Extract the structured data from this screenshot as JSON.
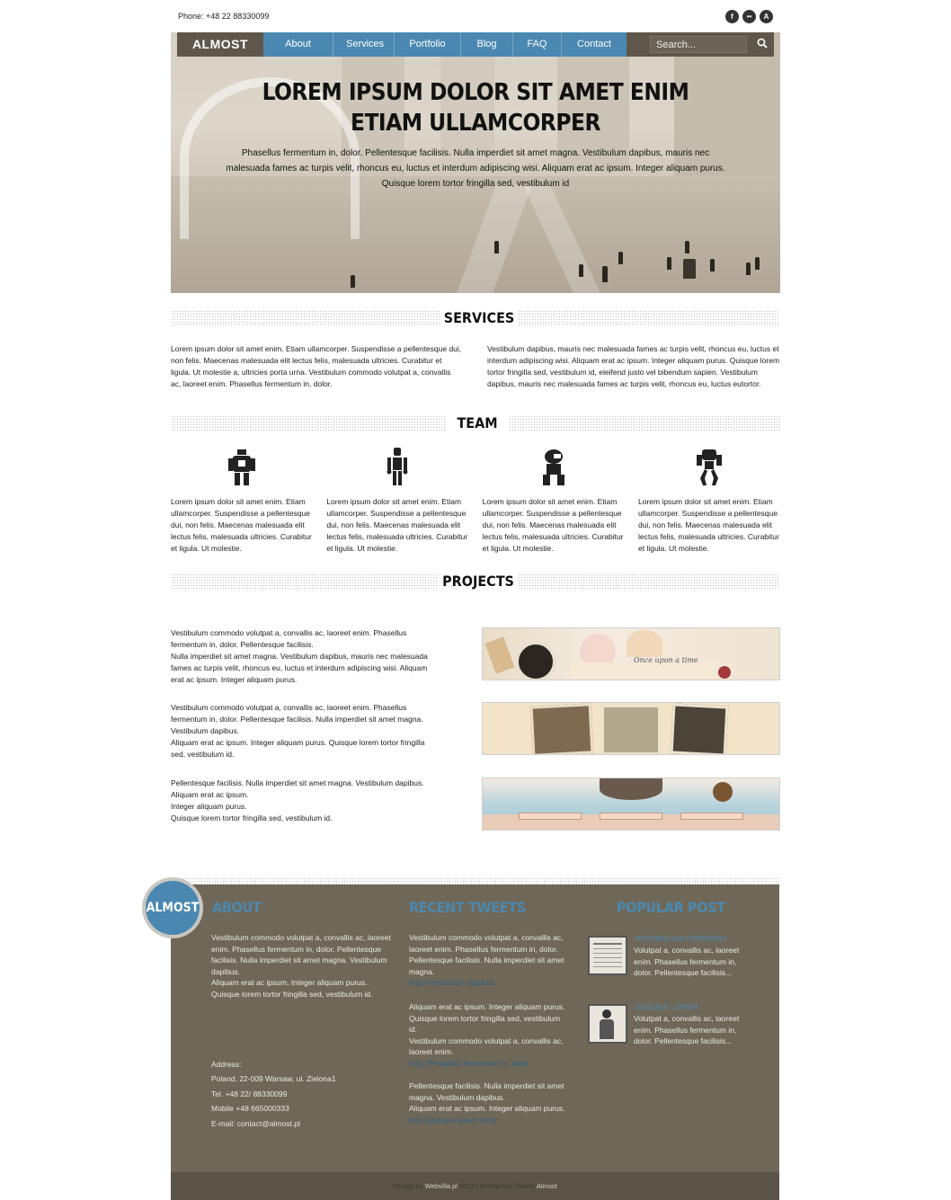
{
  "topbar": {
    "phone": "Phone: +48 22 88330099",
    "social": [
      {
        "icon": "facebook-icon",
        "glyph": "f"
      },
      {
        "icon": "flickr-icon",
        "glyph": "••"
      },
      {
        "icon": "deviantart-icon",
        "glyph": "A"
      }
    ]
  },
  "nav": {
    "logo": "ALMOST",
    "items": [
      "About",
      "Services",
      "Portfolio",
      "Blog",
      "FAQ",
      "Contact"
    ],
    "search_placeholder": "Search..."
  },
  "hero": {
    "title_line1": "LOREM IPSUM DOLOR SIT AMET ENIM",
    "title_line2": "ETIAM ULLAMCORPER",
    "text": "Phasellus fermentum in, dolor. Pellentesque facilisis. Nulla imperdiet sit amet magna. Vestibulum dapibus, mauris nec malesuada fames ac turpis velit, rhoncus eu, luctus et interdum adipiscing wisi. Aliquam erat ac ipsum. Integer aliquam purus. Quisque lorem tortor fringilla sed, vestibulum id"
  },
  "services": {
    "title": "SERVICES",
    "left": "Lorem ipsum dolor sit amet enim. Etiam ullamcorper. Suspendisse a pellentesque dui, non felis. Maecenas malesuada elit lectus felis, malesuada ultricies. Curabitur et ligula. Ut molestie a, ultricies porta urna. Vestibulum commodo volutpat a, convallis ac, laoreet enim. Phasellus fermentum in, dolor.",
    "right": "Vestibulum dapibus, mauris nec malesuada fames ac turpis velit, rhoncus eu, luctus et interdum adipiscing wisi. Aliquam erat ac ipsum. Integer aliquam purus. Quisque lorem tortor fringilla sed, vestibulum id, eleifend justo vel bibendum sapien. Vestibulum dapibus, mauris nec malesuada fames ac turpis velit, rhoncus eu, luctus eutortor."
  },
  "team": {
    "title": "TEAM",
    "members": [
      {
        "icon": "robot-boxy-icon",
        "text": "Lorem ipsum dolor sit amet enim. Etiam ullamcorper. Suspendisse a pellentesque dui, non felis. Maecenas malesuada elit lectus felis, malesuada ultricies. Curabitur et ligula. Ut molestie."
      },
      {
        "icon": "robot-slim-icon",
        "text": "Lorem ipsum dolor sit amet enim. Etiam ullamcorper. Suspendisse a pellentesque dui, non felis. Maecenas malesuada elit lectus felis, malesuada ultricies. Curabitur et ligula. Ut molestie."
      },
      {
        "icon": "robot-crouching-icon",
        "text": "Lorem ipsum dolor sit amet enim. Etiam ullamcorper. Suspendisse a pellentesque dui, non felis. Maecenas malesuada elit lectus felis, malesuada ultricies. Curabitur et ligula. Ut molestie."
      },
      {
        "icon": "robot-mech-icon",
        "text": "Lorem ipsum dolor sit amet enim. Etiam ullamcorper. Suspendisse a pellentesque dui, non felis. Maecenas malesuada elit lectus felis, malesuada ultricies. Curabitur et ligula. Ut molestie."
      }
    ]
  },
  "projects": {
    "title": "PROJECTS",
    "items": [
      {
        "text": "Vestibulum commodo volutpat a, convallis ac, laoreet enim. Phasellus fermentum in, dolor. Pellentesque facilisis.\nNulla imperdiet sit amet magna. Vestibulum dapibus, mauris nec malesuada fames ac turpis velit, rhoncus eu, luctus et interdum adipiscing wisi. Aliquam erat ac ipsum. Integer aliquam purus.",
        "thumb_caption": "Once upon a time"
      },
      {
        "text": "Vestibulum commodo volutpat a, convallis ac, laoreet enim. Phasellus fermentum in, dolor. Pellentesque facilisis. Nulla imperdiet sit amet magna. Vestibulum dapibus.\nAliquam erat ac ipsum. Integer aliquam purus. Quisque lorem tortor fringilla sed, vestibulum id.",
        "thumb_caption": ""
      },
      {
        "text": "Pellentesque facilisis. Nulla imperdiet sit amet magna. Vestibulum dapibus.\nAliquam erat ac ipsum.\nInteger aliquam purus.\nQuisque lorem tortor fringilla sed, vestibulum id.",
        "thumb_caption": ""
      }
    ]
  },
  "footer": {
    "badge": "ALMOST",
    "about_title": "ABOUT",
    "about_text": "Vestibulum commodo volutpat a, convallis ac, laoreet enim. Phasellus fermentum in, dolor. Pellentesque facilisis. Nulla imperdiet sit amet magna. Vestibulum dapibus.\nAliquam erat ac ipsum. Integer aliquam purus.\nQuisque lorem tortor fringilla sed, vestibulum id.",
    "address_label": "Address:",
    "address": "Poland, 22-009 Warsaw, ul. Zielona1",
    "tel": "Tel. +48 22/ 88330099",
    "mobile": "Mobile +48 665000333",
    "email": "E-mail: contact@almost.pl",
    "tweets_title": "RECENT TWEETS",
    "tweets": [
      {
        "text": "Vestibulum commodo volutpat a, convallis ac, laoreet enim. Phasellus fermentum in, dolor. Pellentesque facilisis. Nulla imperdiet sit amet magna.",
        "link": "http://Vestibulum dapibus."
      },
      {
        "text": "Aliquam erat ac ipsum. Integer aliquam purus. Quisque lorem tortor fringilla sed, vestibulum id.\nVestibulum commodo volutpat a, convallis ac, laoreet enim.",
        "link": "http://Phasellus fermentum in, dolor."
      },
      {
        "text": "Pellentesque facilisis. Nulla imperdiet sit amet magna. Vestibulum dapibus.\nAliquam erat ac ipsum. Integer aliquam purus.",
        "link": "http://Quisque lorem tortor"
      }
    ],
    "popular_title": "POPULAR POST",
    "popular": [
      {
        "title": "VESTIBULUM COMMODO",
        "text": "Volutpat a, convallis ac, laoreet enim. Phasellus fermentum in, dolor. Pellentesque facilisis..."
      },
      {
        "title": "QUISQUE LOREM",
        "text": "Volutpat a, convallis ac, laoreet enim. Phasellus fermentum in, dolor. Pellentesque facilisis..."
      }
    ],
    "credits_pre": "Design by",
    "credits_site": "Webvilla.pl",
    "credits_mid": "2012 | Wordpress Theme",
    "credits_theme": "Almost"
  },
  "colors": {
    "accent": "#4a88b1",
    "nav_dark": "#5f574b",
    "footer_bg": "#6f6859"
  }
}
